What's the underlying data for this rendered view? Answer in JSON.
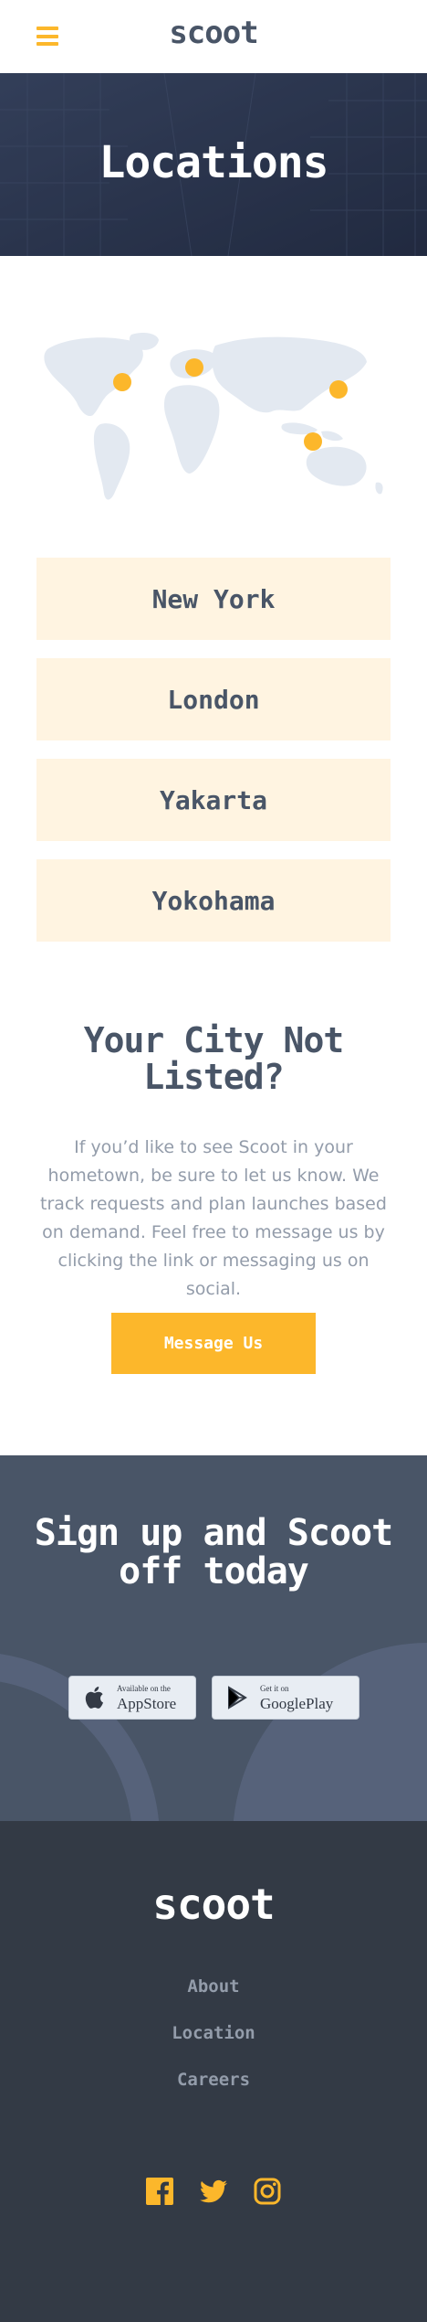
{
  "header": {
    "logo": "scoot",
    "menu_icon": "hamburger-menu-icon"
  },
  "hero": {
    "title": "Locations"
  },
  "map": {
    "alt_icon": "world-map",
    "pin_color": "#FCB72B"
  },
  "locations": [
    {
      "label": "New York"
    },
    {
      "label": "London"
    },
    {
      "label": "Yakarta"
    },
    {
      "label": "Yokohama"
    }
  ],
  "city_not_listed": {
    "title_line1": "Your City Not",
    "title_line2": "Listed?",
    "body": "If you’d like to see Scoot in your hometown, be sure to let us know. We track requests and plan launches based on demand. Feel free to message us by clicking the link or messaging us on social.",
    "button_label": "Message Us"
  },
  "signup": {
    "title_line1": "Sign up and Scoot",
    "title_line2": "off today",
    "app_store": {
      "small": "Available on the",
      "big": "AppStore",
      "icon": "apple-icon"
    },
    "google_play": {
      "small": "Get it on",
      "big": "GooglePlay",
      "icon": "google-play-icon"
    }
  },
  "footer": {
    "logo": "scoot",
    "links": [
      {
        "label": "About"
      },
      {
        "label": "Location"
      },
      {
        "label": "Careers"
      }
    ],
    "social": [
      {
        "icon": "facebook-icon"
      },
      {
        "icon": "twitter-icon"
      },
      {
        "icon": "instagram-icon"
      }
    ]
  },
  "colors": {
    "accent": "#FCB72B",
    "dark_navy": "#333A45",
    "dim_grey": "#495567",
    "light_cream": "#FFF4E1",
    "body_text": "#939CAA"
  }
}
